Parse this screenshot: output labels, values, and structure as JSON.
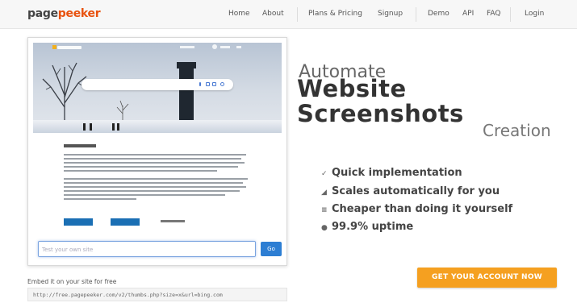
{
  "brand": {
    "part1": "page",
    "part2": "peeker"
  },
  "nav": {
    "home": "Home",
    "about": "About",
    "plans": "Plans & Pricing",
    "signup": "Signup",
    "demo": "Demo",
    "api": "API",
    "faq": "FAQ",
    "login": "Login"
  },
  "preview": {
    "input_placeholder": "Test your own site",
    "go_label": "Go"
  },
  "hero": {
    "automate": "Automate",
    "website": "Website",
    "screenshots": "Screenshots",
    "creation": "Creation"
  },
  "features": [
    {
      "icon": "pencil-icon",
      "glyph": "✓",
      "label": "Quick implementation"
    },
    {
      "icon": "chart-icon",
      "glyph": "◢",
      "label": "Scales automatically for you"
    },
    {
      "icon": "list-icon",
      "glyph": "≡",
      "label": "Cheaper than doing it yourself"
    },
    {
      "icon": "circle-icon",
      "glyph": "●",
      "label": "99.9% uptime"
    }
  ],
  "cta_label": "GET YOUR ACCOUNT NOW",
  "embed": {
    "label": "Embed it on your site for free",
    "code": "http://free.pagepeeker.com/v2/thumbs.php?size=x&url=bing.com"
  },
  "colors": {
    "brand_orange": "#e8520f",
    "cta_orange": "#f5a020",
    "go_blue": "#2d7ed3"
  }
}
